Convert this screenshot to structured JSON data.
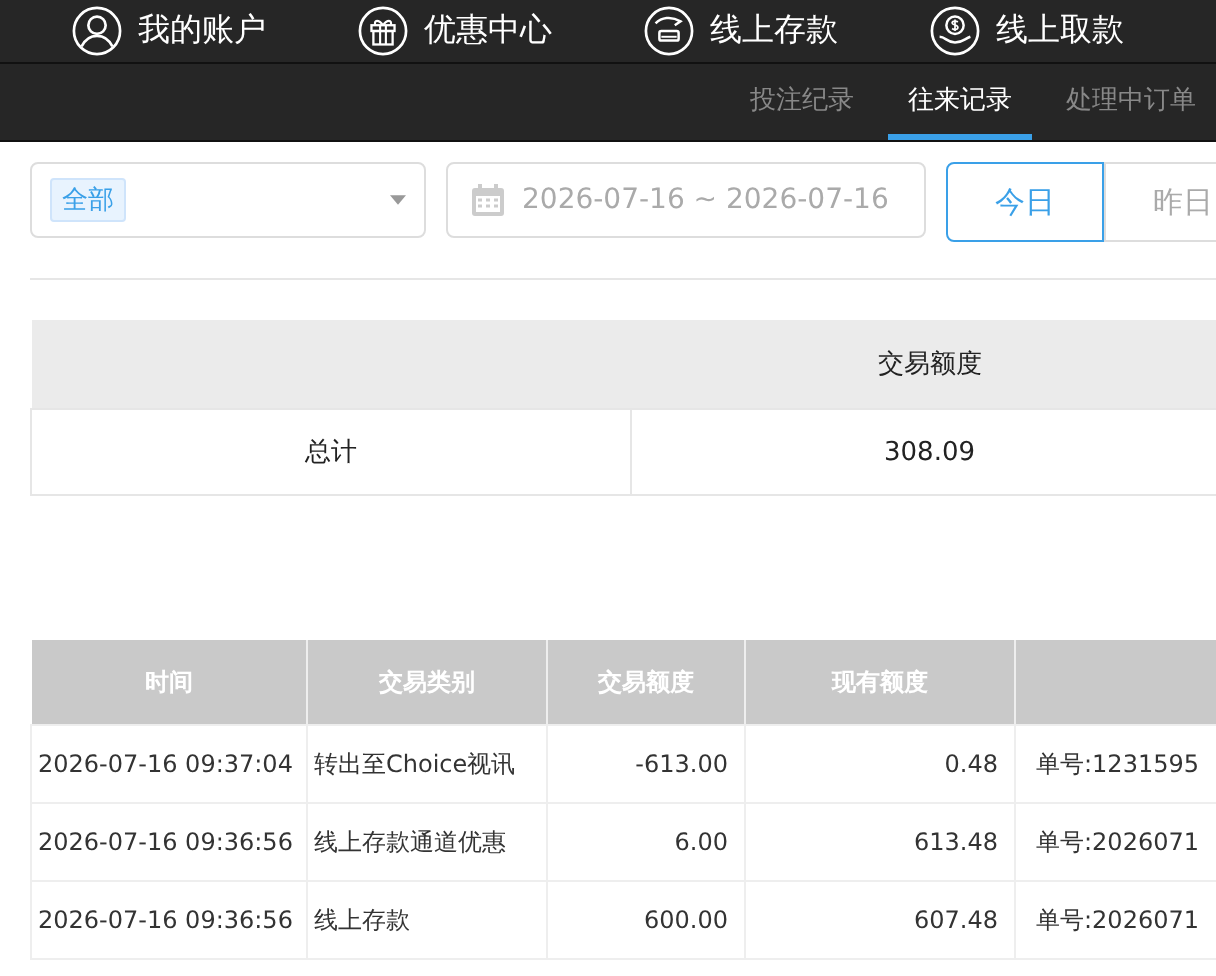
{
  "top_nav": [
    {
      "label": "我的账户"
    },
    {
      "label": "优惠中心"
    },
    {
      "label": "线上存款"
    },
    {
      "label": "线上取款"
    }
  ],
  "tabs": [
    {
      "label": "投注纪录",
      "selected": false
    },
    {
      "label": "往来记录",
      "selected": true
    },
    {
      "label": "处理中订单",
      "selected": false
    }
  ],
  "filters": {
    "type_select": {
      "tag": "全部"
    },
    "date_range": {
      "value": "2026-07-16 ~ 2026-07-16"
    },
    "quick_buttons": [
      {
        "label": "今日",
        "selected": true
      },
      {
        "label": "昨日",
        "selected": false
      }
    ]
  },
  "summary": {
    "columns": [
      "",
      "交易额度"
    ],
    "rows": [
      [
        "总计",
        "308.09"
      ]
    ]
  },
  "table": {
    "columns": [
      "时间",
      "交易类别",
      "交易额度",
      "现有额度",
      ""
    ],
    "rows": [
      [
        "2026-07-16 09:37:04",
        "转出至Choice视讯",
        "-613.00",
        "0.48",
        "单号:1231595"
      ],
      [
        "2026-07-16 09:36:56",
        "线上存款通道优惠",
        "6.00",
        "613.48",
        "单号:2026071"
      ],
      [
        "2026-07-16 09:36:56",
        "线上存款",
        "600.00",
        "607.48",
        "单号:2026071"
      ]
    ]
  }
}
